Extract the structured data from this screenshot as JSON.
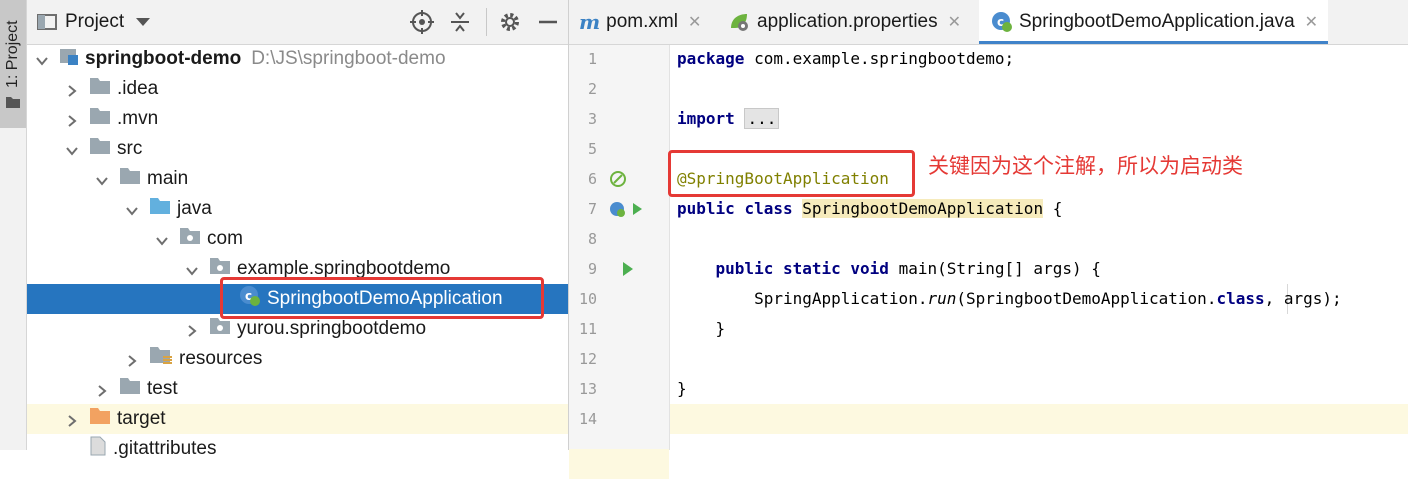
{
  "side_strip": {
    "tab_label": "1: Project"
  },
  "project_panel": {
    "title": "Project",
    "header_buttons": [
      "target-icon",
      "collapse-icon",
      "gear-icon",
      "minimize-icon"
    ],
    "tree": [
      {
        "label": "springboot-demo",
        "sub": "D:\\JS\\springboot-demo",
        "bold": true,
        "expanded": true,
        "depth": 0,
        "icon": "module-icon"
      },
      {
        "label": ".idea",
        "expanded": false,
        "depth": 1,
        "icon": "folder-icon"
      },
      {
        "label": ".mvn",
        "expanded": false,
        "depth": 1,
        "icon": "folder-icon"
      },
      {
        "label": "src",
        "expanded": true,
        "depth": 1,
        "icon": "folder-icon"
      },
      {
        "label": "main",
        "expanded": true,
        "depth": 2,
        "icon": "folder-icon"
      },
      {
        "label": "java",
        "expanded": true,
        "depth": 3,
        "icon": "source-folder-icon"
      },
      {
        "label": "com",
        "expanded": true,
        "depth": 4,
        "icon": "package-icon"
      },
      {
        "label": "example.springbootdemo",
        "expanded": true,
        "depth": 5,
        "icon": "package-icon"
      },
      {
        "label": "SpringbootDemoApplication",
        "depth": 6,
        "icon": "spring-class-icon",
        "selected": true
      },
      {
        "label": "yurou.springbootdemo",
        "expanded": false,
        "depth": 5,
        "icon": "package-icon"
      },
      {
        "label": "resources",
        "expanded": false,
        "depth": 3,
        "icon": "resources-folder-icon"
      },
      {
        "label": "test",
        "expanded": false,
        "depth": 2,
        "icon": "folder-icon"
      },
      {
        "label": "target",
        "expanded": false,
        "depth": 1,
        "icon": "excluded-folder-icon",
        "highlighted": true
      },
      {
        "label": ".gitattributes",
        "depth": 1,
        "icon": "file-icon"
      }
    ]
  },
  "editor": {
    "tabs": [
      {
        "label": "pom.xml",
        "icon": "maven-icon",
        "active": false
      },
      {
        "label": "application.properties",
        "icon": "spring-properties-icon",
        "active": false
      },
      {
        "label": "SpringbootDemoApplication.java",
        "icon": "spring-class-icon",
        "active": true
      }
    ],
    "lines": [
      {
        "n": "1",
        "code": "package com.example.springbootdemo;"
      },
      {
        "n": "2",
        "code": ""
      },
      {
        "n": "3",
        "code": "import ..."
      },
      {
        "n": "5",
        "code": ""
      },
      {
        "n": "6",
        "code": "@SpringBootApplication"
      },
      {
        "n": "7",
        "code": "public class SpringbootDemoApplication {"
      },
      {
        "n": "8",
        "code": ""
      },
      {
        "n": "9",
        "code": "    public static void main(String[] args) {"
      },
      {
        "n": "10",
        "code": "        SpringApplication.run(SpringbootDemoApplication.class, args);"
      },
      {
        "n": "11",
        "code": "    }"
      },
      {
        "n": "12",
        "code": ""
      },
      {
        "n": "13",
        "code": "}"
      },
      {
        "n": "14",
        "code": ""
      }
    ],
    "tokens": {
      "package_kw": "package",
      "package_name": " com.example.springbootdemo;",
      "import_kw": "import",
      "import_fold": "...",
      "annotation": "@SpringBootApplication",
      "public_kw": "public",
      "class_kw": "class",
      "class_name": "SpringbootDemoApplication",
      "open_brace": " {",
      "static_kw": "static",
      "void_kw": "void",
      "main_sig": " main(String[] args) {",
      "call_prefix": "SpringApplication.",
      "call_method": "run",
      "call_arg": "(SpringbootDemoApplication.",
      "class_kw2": "class",
      "call_suffix": ", args);",
      "close_inner": "}",
      "close_outer": "}"
    }
  },
  "annotation_note": "关键因为这个注解，所以为启动类",
  "colors": {
    "selection": "#2675bf",
    "annotation_box": "#e53935",
    "keyword": "#000080",
    "annotation": "#808000"
  }
}
